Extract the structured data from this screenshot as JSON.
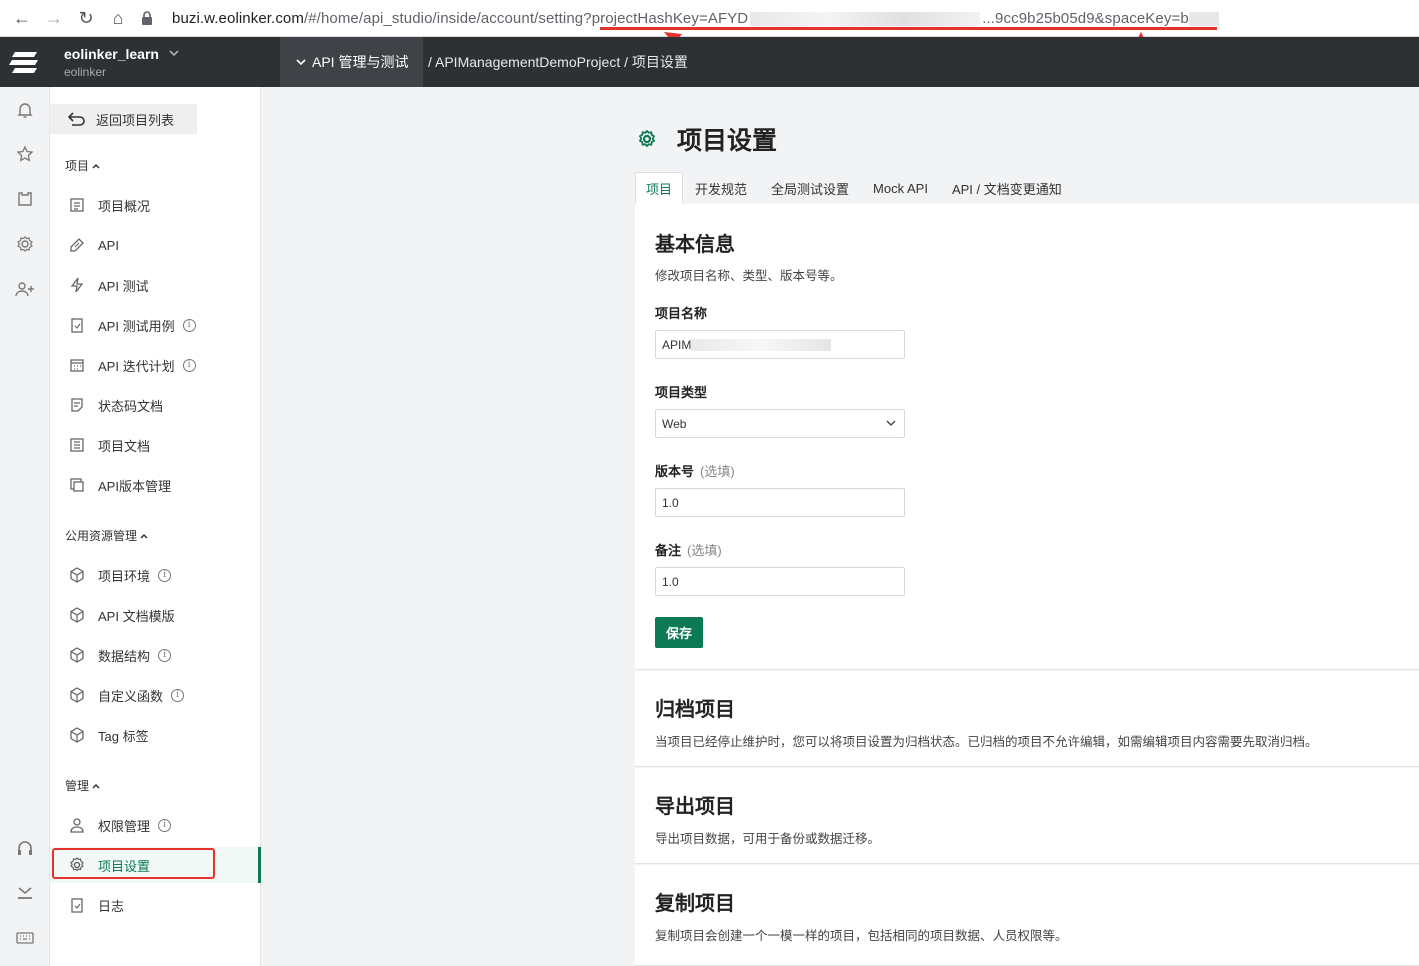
{
  "browser": {
    "url_host": "buzi.w.eolinker.com",
    "url_path_pre": "/#/home/api_studio/inside/account/setting",
    "url_query_start": "?projectHashKey=AFYD",
    "url_query_mid": "...9cc9b25b05d9&spaceKey=b",
    "nav_back": "←",
    "nav_forward": "→",
    "nav_reload": "↻",
    "nav_home": "⌂",
    "annotation_color": "#e5322d"
  },
  "header": {
    "workspace_name": "eolinker_learn",
    "workspace_sub": "eolinker",
    "module_tab": "API 管理与测试",
    "breadcrumb": "/ APIManagementDemoProject / 项目设置"
  },
  "sidebar": {
    "back_label": "返回项目列表",
    "groups": [
      {
        "title": "项目",
        "items": [
          {
            "label": "项目概况",
            "icon": "overview-icon"
          },
          {
            "label": "API",
            "icon": "api-icon"
          },
          {
            "label": "API 测试",
            "icon": "lightning-icon"
          },
          {
            "label": "API 测试用例",
            "icon": "clipboard-icon",
            "info": "i"
          },
          {
            "label": "API 迭代计划",
            "icon": "calendar-icon",
            "info": "i"
          },
          {
            "label": "状态码文档",
            "icon": "doc-icon"
          },
          {
            "label": "项目文档",
            "icon": "list-doc-icon"
          },
          {
            "label": "API版本管理",
            "icon": "versions-icon"
          }
        ]
      },
      {
        "title": "公用资源管理",
        "items": [
          {
            "label": "项目环境",
            "icon": "cube-icon",
            "info": "i"
          },
          {
            "label": "API 文档模版",
            "icon": "cube-icon"
          },
          {
            "label": "数据结构",
            "icon": "cube-icon",
            "info": "i"
          },
          {
            "label": "自定义函数",
            "icon": "cube-icon",
            "info": "i"
          },
          {
            "label": "Tag 标签",
            "icon": "cube-icon"
          }
        ]
      },
      {
        "title": "管理",
        "items": [
          {
            "label": "权限管理",
            "icon": "user-icon",
            "info": "i"
          },
          {
            "label": "项目设置",
            "icon": "gear-icon",
            "active": true
          },
          {
            "label": "日志",
            "icon": "clipboard-icon"
          }
        ]
      }
    ]
  },
  "main": {
    "page_title": "项目设置",
    "tabs": [
      "项目",
      "开发规范",
      "全局测试设置",
      "Mock API",
      "API / 文档变更通知"
    ],
    "basic": {
      "title": "基本信息",
      "desc": "修改项目名称、类型、版本号等。",
      "name_label": "项目名称",
      "name_value": "APIM",
      "type_label": "项目类型",
      "type_value": "Web",
      "version_label": "版本号",
      "version_opt": "(选填)",
      "version_value": "1.0",
      "remark_label": "备注",
      "remark_opt": "(选填)",
      "remark_value": "1.0",
      "save_label": "保存"
    },
    "archive": {
      "title": "归档项目",
      "desc": "当项目已经停止维护时，您可以将项目设置为归档状态。已归档的项目不允许编辑，如需编辑项目内容需要先取消归档。"
    },
    "export": {
      "title": "导出项目",
      "desc": "导出项目数据，可用于备份或数据迁移。"
    },
    "copy": {
      "title": "复制项目",
      "desc": "复制项目会创建一个一模一样的项目，包括相同的项目数据、人员权限等。"
    }
  },
  "colors": {
    "accent": "#0c7a55",
    "header_bg": "#2e3134"
  }
}
